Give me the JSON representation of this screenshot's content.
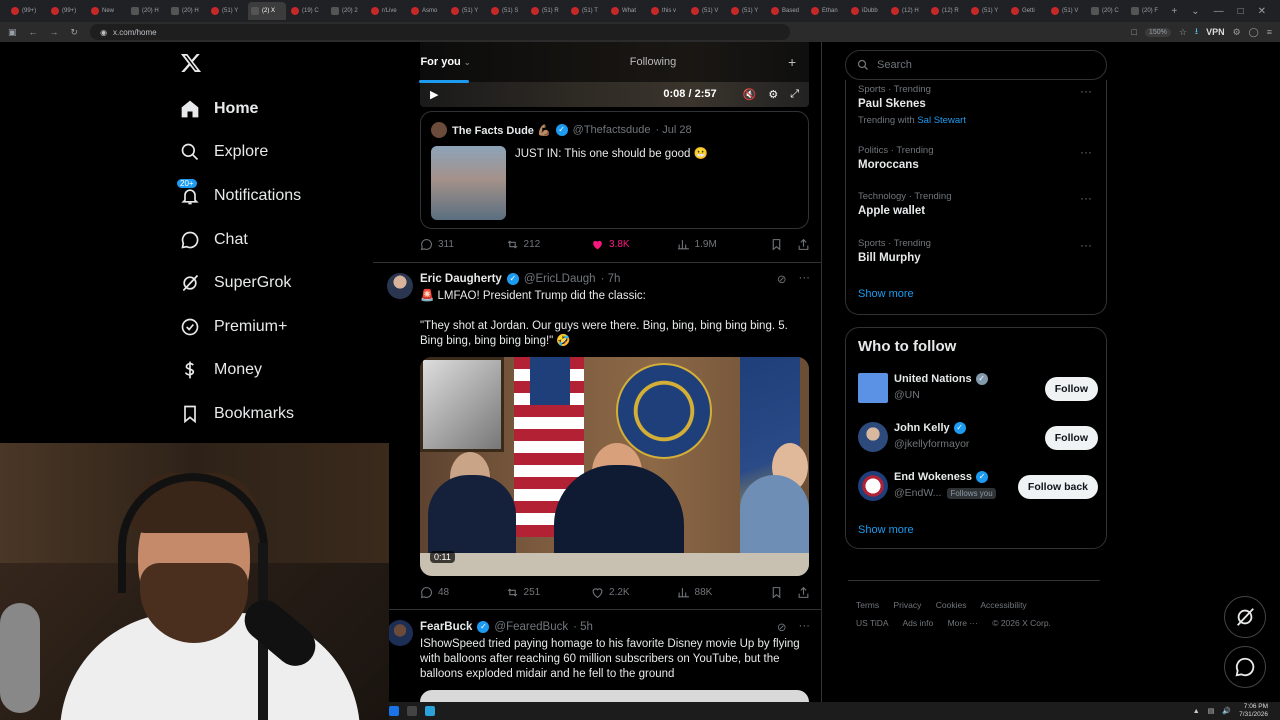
{
  "browser": {
    "tabs": [
      {
        "label": "(99+)"
      },
      {
        "label": "(99+)"
      },
      {
        "label": "New"
      },
      {
        "label": "(20) H"
      },
      {
        "label": "(20) H"
      },
      {
        "label": "(51) Y"
      },
      {
        "label": "(2) X"
      },
      {
        "label": "(19) C"
      },
      {
        "label": "(20) 2"
      },
      {
        "label": "r/Live"
      },
      {
        "label": "Asmo"
      },
      {
        "label": "(51) Y"
      },
      {
        "label": "(51) S"
      },
      {
        "label": "(51) R"
      },
      {
        "label": "(51) T"
      },
      {
        "label": "What"
      },
      {
        "label": "this v"
      },
      {
        "label": "(51) V"
      },
      {
        "label": "(51) Y"
      },
      {
        "label": "Based"
      },
      {
        "label": "Ethan"
      },
      {
        "label": "iDubb"
      },
      {
        "label": "(12) H"
      },
      {
        "label": "(12) R"
      },
      {
        "label": "(51) Y"
      },
      {
        "label": "Getti"
      },
      {
        "label": "(51) V"
      },
      {
        "label": "(20) C"
      },
      {
        "label": "(20) F"
      }
    ],
    "url": "x.com/home",
    "zoom": "150%",
    "vpn": "VPN"
  },
  "nav": {
    "items": [
      {
        "label": "Home",
        "icon": "home-icon"
      },
      {
        "label": "Explore",
        "icon": "search-icon"
      },
      {
        "label": "Notifications",
        "icon": "bell-icon",
        "badge": "20+"
      },
      {
        "label": "Chat",
        "icon": "chat-icon"
      },
      {
        "label": "SuperGrok",
        "icon": "grok-icon"
      },
      {
        "label": "Premium+",
        "icon": "premium-icon"
      },
      {
        "label": "Money",
        "icon": "money-icon"
      },
      {
        "label": "Bookmarks",
        "icon": "bookmark-icon"
      }
    ]
  },
  "feed": {
    "tab_for_you": "For you",
    "tab_following": "Following",
    "video_time": "0:08 / 2:57",
    "quote": {
      "name": "The Facts Dude 💪🏽",
      "handle": "@Thefactsdude",
      "date": "· Jul 28",
      "text": "JUST IN: This one should be good 😬"
    },
    "actions1": {
      "replies": "311",
      "reposts": "212",
      "likes": "3.8K",
      "views": "1.9M"
    },
    "tweet2": {
      "name": "Eric Daugherty",
      "handle": "@EricLDaugh",
      "time": "· 7h",
      "line1": "🚨 LMFAO! President Trump did the classic:",
      "line2": "\"They shot at Jordan. Our guys were there. Bing, bing, bing bing bing. 5. Bing bing, bing bing bing!\" 🤣",
      "duration": "0:11"
    },
    "actions2": {
      "replies": "48",
      "reposts": "251",
      "likes": "2.2K",
      "views": "88K"
    },
    "tweet3": {
      "name": "FearBuck",
      "handle": "@FearedBuck",
      "time": "· 5h",
      "text": "IShowSpeed tried paying homage to his favorite Disney movie Up by flying with balloons after reaching 60 million subscribers on YouTube, but the balloons exploded midair and he fell to the ground"
    }
  },
  "sidebar": {
    "search_placeholder": "Search",
    "trends": [
      {
        "category": "Sports · Trending",
        "title": "Paul Skenes",
        "with_label": "Trending with",
        "with_link": "Sal Stewart"
      },
      {
        "category": "Politics · Trending",
        "title": "Moroccans"
      },
      {
        "category": "Technology · Trending",
        "title": "Apple wallet"
      },
      {
        "category": "Sports · Trending",
        "title": "Bill Murphy"
      }
    ],
    "trends_show_more": "Show more",
    "who_to_follow": {
      "title": "Who to follow",
      "accounts": [
        {
          "name": "United Nations",
          "handle": "@UN",
          "button": "Follow"
        },
        {
          "name": "John Kelly",
          "handle": "@jkellyformayor",
          "button": "Follow"
        },
        {
          "name": "End Wokeness",
          "handle": "@EndW...",
          "follows_you": "Follows you",
          "button": "Follow back"
        }
      ],
      "show_more": "Show more"
    },
    "footer": {
      "links_row1": [
        "Terms",
        "Privacy",
        "Cookies",
        "Accessibility"
      ],
      "links_row2": [
        "US TiDA",
        "Ads info",
        "More ···",
        "© 2026 X Corp."
      ]
    }
  },
  "taskbar": {
    "time": "7:06 PM",
    "date": "7/31/2026"
  },
  "colors": {
    "accent": "#1d9bf0",
    "like": "#f91880",
    "bg": "#000000"
  }
}
